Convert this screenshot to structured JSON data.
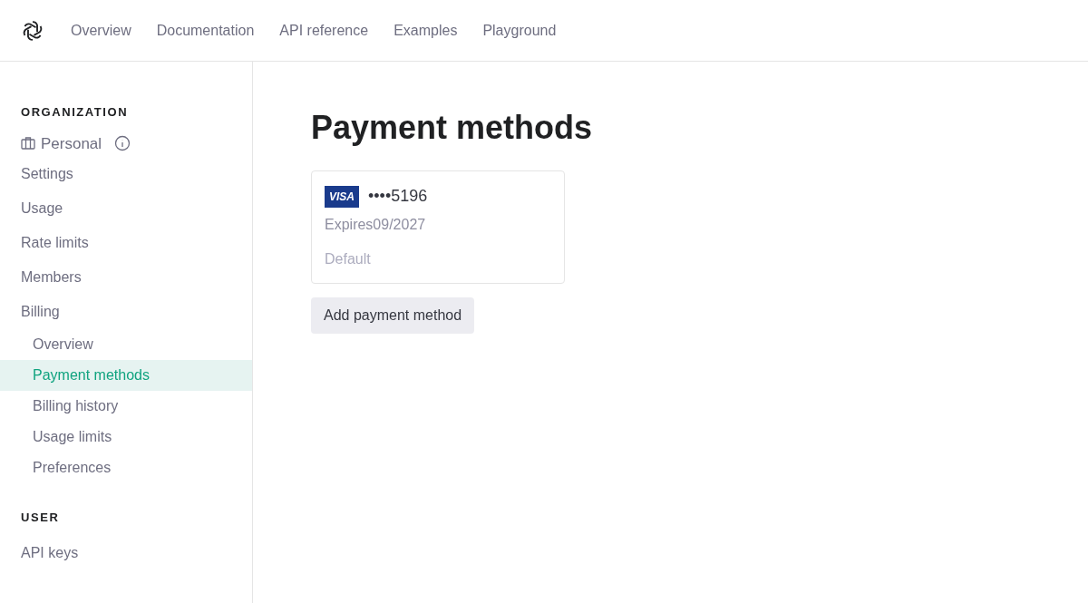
{
  "top_nav": {
    "links": [
      "Overview",
      "Documentation",
      "API reference",
      "Examples",
      "Playground"
    ]
  },
  "sidebar": {
    "sections": [
      {
        "heading": "ORGANIZATION",
        "org": {
          "name": "Personal"
        },
        "items": [
          {
            "label": "Settings",
            "selected": false
          },
          {
            "label": "Usage",
            "selected": false
          },
          {
            "label": "Rate limits",
            "selected": false
          },
          {
            "label": "Members",
            "selected": false
          },
          {
            "label": "Billing",
            "selected": false,
            "children": [
              {
                "label": "Overview",
                "selected": false
              },
              {
                "label": "Payment methods",
                "selected": true
              },
              {
                "label": "Billing history",
                "selected": false
              },
              {
                "label": "Usage limits",
                "selected": false
              },
              {
                "label": "Preferences",
                "selected": false
              }
            ]
          }
        ]
      },
      {
        "heading": "USER",
        "items": [
          {
            "label": "API keys",
            "selected": false
          }
        ]
      }
    ]
  },
  "main": {
    "title": "Payment methods",
    "cards": [
      {
        "brand": "VISA",
        "number": "••••5196",
        "expiry": "Expires09/2027",
        "status": "Default"
      }
    ],
    "add_button": "Add payment method"
  }
}
